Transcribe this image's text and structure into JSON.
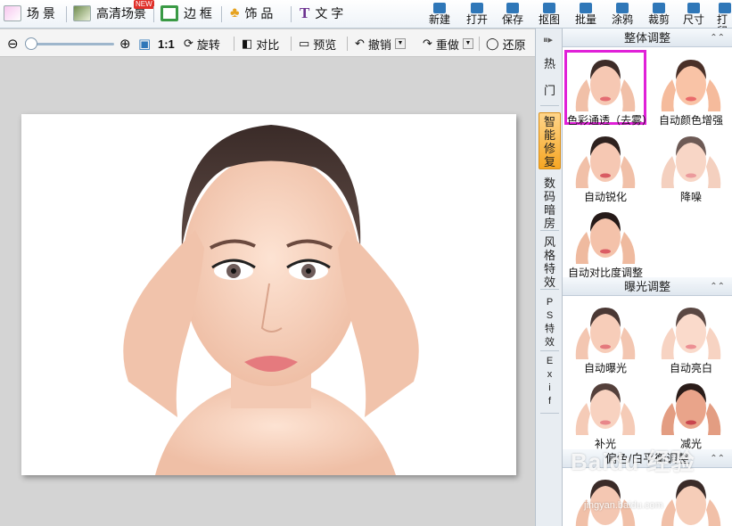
{
  "toolbar_left": [
    {
      "label": "场 景",
      "icon": "scene-icon"
    },
    {
      "label": "高清场景",
      "icon": "hd-scene-icon"
    },
    {
      "label": "边 框",
      "icon": "frame-icon"
    },
    {
      "label": "饰 品",
      "icon": "decoration-icon"
    },
    {
      "label": "文 字",
      "icon": "text-icon"
    }
  ],
  "toolbar_right": [
    {
      "label": "新建",
      "icon": "new-file-icon"
    },
    {
      "label": "打开",
      "icon": "open-folder-icon"
    },
    {
      "label": "保存",
      "icon": "save-icon"
    },
    {
      "label": "抠图",
      "icon": "cutout-icon"
    },
    {
      "label": "批量",
      "icon": "batch-icon"
    },
    {
      "label": "涂鸦",
      "icon": "doodle-icon"
    },
    {
      "label": "裁剪",
      "icon": "crop-icon"
    },
    {
      "label": "尺寸",
      "icon": "resize-icon"
    },
    {
      "label": "打印",
      "icon": "print-icon"
    }
  ],
  "subbar": {
    "ratio_label": "1:1",
    "rotate": "旋转",
    "compare": "对比",
    "preview": "预览",
    "undo": "撤销",
    "redo": "重做",
    "restore": "还原",
    "zoom_level": 0.05
  },
  "side_tabs": [
    "热\n\n门",
    "智\n能\n修\n复",
    "数\n码\n暗\n房",
    "风\n格\n特\n效",
    "P\nS\n特\n效",
    "E\nx\ni\nf"
  ],
  "sections": {
    "overall": "整体调整",
    "exposure": "曝光调整",
    "balance": "偏色/白平衡调整"
  },
  "overall_items": [
    "色彩通透（去雾）",
    "自动颜色增强",
    "自动锐化",
    "降噪",
    "自动对比度调整"
  ],
  "exposure_items": [
    "自动曝光",
    "自动亮白",
    "补光",
    "减光"
  ],
  "watermark": "Baidu 经验",
  "watermark_url": "jingyan.baidu.com",
  "colors": {
    "accent": "#f5a623",
    "selection": "#e020d8",
    "brand_blue": "#2f77b8"
  }
}
